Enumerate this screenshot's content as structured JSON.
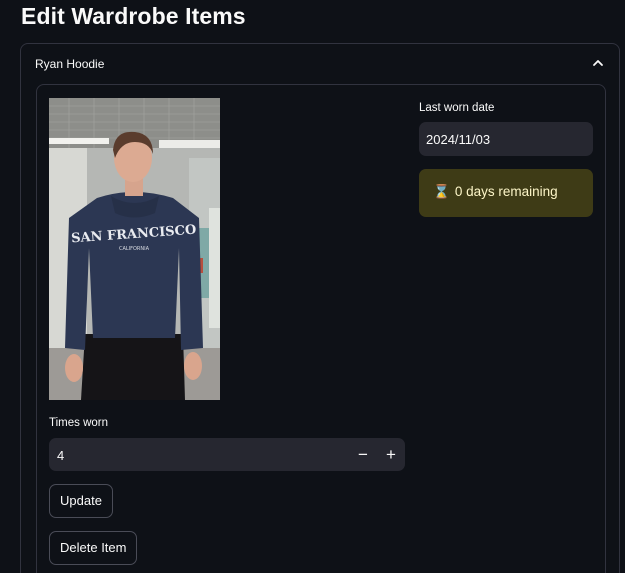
{
  "page": {
    "title": "Edit Wardrobe Items"
  },
  "item": {
    "name": "Ryan Hoodie",
    "expanded": true,
    "photo": {
      "hoodie_text": "SAN FRANCISCO",
      "hoodie_subtext": "CALIFORNIA"
    },
    "last_worn": {
      "label": "Last worn date",
      "value": "2024/11/03"
    },
    "status": {
      "icon": "hourglass-icon",
      "glyph": "⌛",
      "text": "0 days remaining"
    },
    "times_worn": {
      "label": "Times worn",
      "value": "4",
      "minus": "−",
      "plus": "+"
    },
    "buttons": {
      "update": "Update",
      "delete": "Delete Item"
    }
  },
  "colors": {
    "background": "#0e1117",
    "input_bg": "#262730",
    "border": "#31333f",
    "warning_bg": "#3e3b16",
    "warning_text": "#fdf6c8"
  }
}
